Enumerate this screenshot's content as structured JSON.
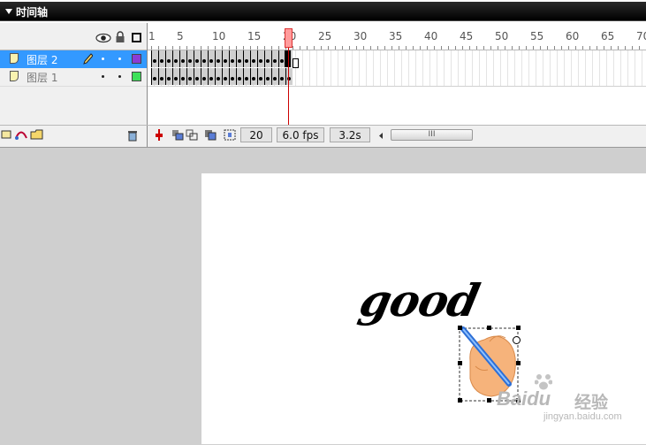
{
  "panel": {
    "title": "时间轴"
  },
  "layers": [
    {
      "name": "图层 2",
      "selected": true,
      "color": "#8b3bd6"
    },
    {
      "name": "图层 1",
      "selected": false,
      "color": "#3ee05a"
    }
  ],
  "ruler": {
    "labels": [
      "1",
      "5",
      "10",
      "15",
      "20",
      "25",
      "30",
      "35",
      "40",
      "45",
      "50",
      "55",
      "60",
      "65",
      "70"
    ]
  },
  "status": {
    "current_frame": "20",
    "frame_rate": "6.0 fps",
    "elapsed": "3.2s",
    "scroll_grip": "III"
  },
  "stage": {
    "text": "good"
  },
  "watermark": {
    "brand": "Baidu",
    "brand_cn": "经验",
    "url": "jingyan.baidu.com"
  },
  "colors": {
    "selected_row": "#3399ff",
    "playhead": "#cc0000",
    "title_bar": "#000000"
  },
  "icons": [
    "eye-icon",
    "lock-icon",
    "outline-icon",
    "pencil-icon",
    "page-icon",
    "add-layer-icon",
    "add-guide-icon",
    "add-folder-icon",
    "trash-icon",
    "center-frame-icon",
    "onion-skin-icon",
    "onion-outline-icon",
    "edit-multiple-icon",
    "modify-onion-icon",
    "scroll-left-icon"
  ]
}
